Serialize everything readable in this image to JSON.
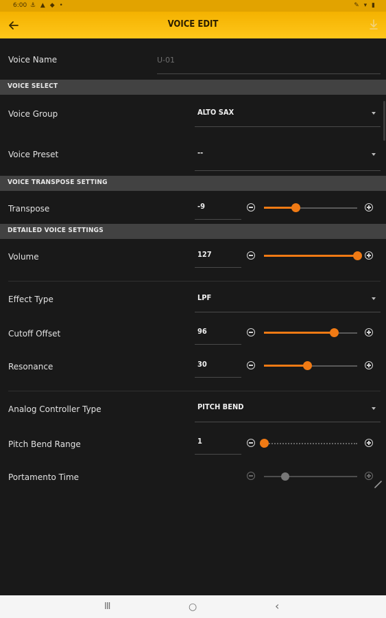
{
  "status_bar": {
    "time": "6:00",
    "left_icons": "⚓ ▲ ◆ •",
    "right_icons": "✎ ▾ ▮"
  },
  "app_bar": {
    "title": "VOICE EDIT",
    "back_icon": "arrow-left-icon",
    "right_icon": "download-icon"
  },
  "voice_name": {
    "label": "Voice Name",
    "placeholder": "U-01"
  },
  "sections": {
    "voice_select": "VOICE SELECT",
    "transpose": "VOICE TRANSPOSE SETTING",
    "detailed": "DETAILED VOICE SETTINGS"
  },
  "voice_group": {
    "label": "Voice Group",
    "value": "ALTO SAX"
  },
  "voice_preset": {
    "label": "Voice Preset",
    "value": "--"
  },
  "transpose": {
    "label": "Transpose",
    "value": "-9",
    "level": 0.34
  },
  "volume": {
    "label": "Volume",
    "value": "127",
    "level": 1.0
  },
  "effect_type": {
    "label": "Effect Type",
    "value": "LPF"
  },
  "cutoff_offset": {
    "label": "Cutoff Offset",
    "value": "96",
    "level": 0.75
  },
  "resonance": {
    "label": "Resonance",
    "value": "30",
    "level": 0.47
  },
  "analog_controller": {
    "label": "Analog Controller Type",
    "value": "PITCH BEND"
  },
  "pitch_bend_range": {
    "label": "Pitch Bend Range",
    "value": "1",
    "level": 0.0
  },
  "portamento_time": {
    "label": "Portamento Time",
    "level": 0.23
  },
  "nav_bar": {
    "recents": "III",
    "home": "○",
    "back": "‹"
  },
  "colors": {
    "accent": "#f07a14",
    "app_bar": "#ffc61a",
    "background": "#191919",
    "section": "#424242"
  }
}
